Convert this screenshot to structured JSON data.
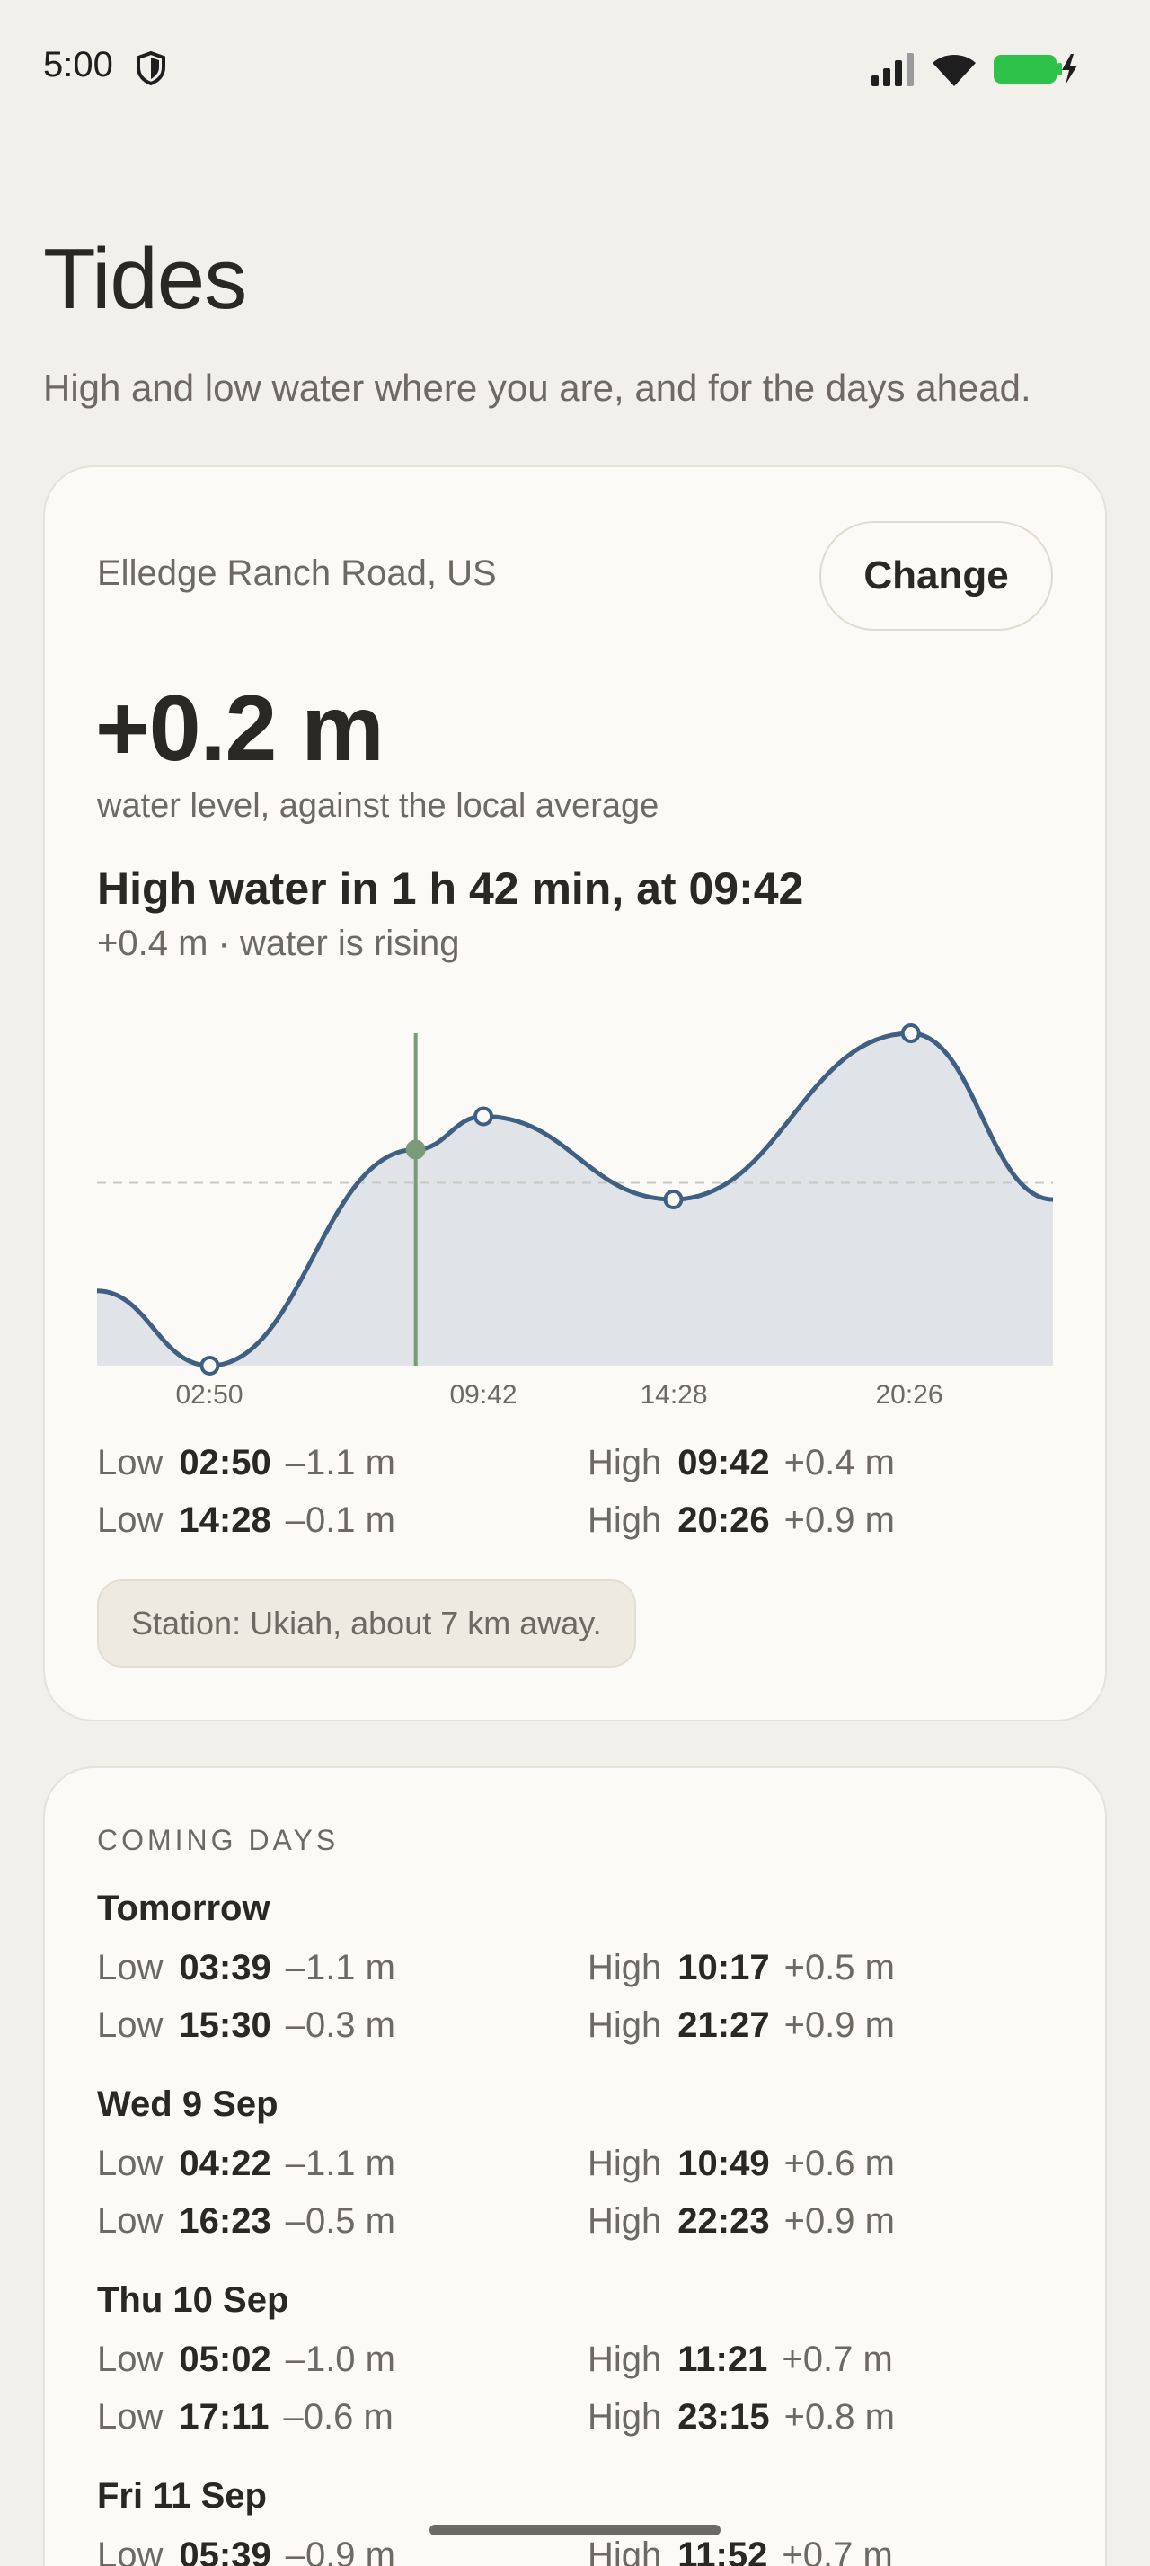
{
  "status": {
    "time": "5:00"
  },
  "page": {
    "title": "Tides",
    "subtitle": "High and low water where you are, and for the days ahead."
  },
  "current": {
    "location": "Elledge Ranch Road, US",
    "change_label": "Change",
    "level": "+0.2 m",
    "level_caption": "water level, against the local average",
    "next_tide": "High water in 1 h 42 min, at 09:42",
    "next_tide_sub": "+0.4 m · water is rising",
    "station": "Station: Ukiah, about 7 km away.",
    "extremes": [
      {
        "kind": "Low",
        "time": "02:50",
        "height": "–1.1 m"
      },
      {
        "kind": "High",
        "time": "09:42",
        "height": "+0.4 m"
      },
      {
        "kind": "Low",
        "time": "14:28",
        "height": "–0.1 m"
      },
      {
        "kind": "High",
        "time": "20:26",
        "height": "+0.9 m"
      }
    ]
  },
  "chart_data": {
    "type": "area",
    "x_tick_labels": [
      "02:50",
      "09:42",
      "14:28",
      "20:26"
    ],
    "y_unit": "m",
    "ylim": [
      -1.1,
      0.9
    ],
    "points": [
      {
        "t": 0.0,
        "h": -0.65
      },
      {
        "t": 2.83,
        "h": -1.1
      },
      {
        "t": 8.0,
        "h": 0.2
      },
      {
        "t": 9.7,
        "h": 0.4
      },
      {
        "t": 14.47,
        "h": -0.1
      },
      {
        "t": 20.43,
        "h": 0.9
      },
      {
        "t": 24.0,
        "h": -0.1
      }
    ],
    "extremes": [
      {
        "t": 2.83,
        "h": -1.1
      },
      {
        "t": 9.7,
        "h": 0.4
      },
      {
        "t": 14.47,
        "h": -0.1
      },
      {
        "t": 20.43,
        "h": 0.9
      }
    ],
    "now": {
      "t": 8.0,
      "h": 0.2
    },
    "reference_line_h": 0.0,
    "colors": {
      "line": "#3f5f83",
      "fill": "#e0e4e8",
      "now": "#7a9a78",
      "reference": "#c8c8c4"
    }
  },
  "coming_days": {
    "heading": "COMING DAYS",
    "days": [
      {
        "name": "Tomorrow",
        "extremes": [
          {
            "kind": "Low",
            "time": "03:39",
            "height": "–1.1 m"
          },
          {
            "kind": "High",
            "time": "10:17",
            "height": "+0.5 m"
          },
          {
            "kind": "Low",
            "time": "15:30",
            "height": "–0.3 m"
          },
          {
            "kind": "High",
            "time": "21:27",
            "height": "+0.9 m"
          }
        ]
      },
      {
        "name": "Wed 9 Sep",
        "extremes": [
          {
            "kind": "Low",
            "time": "04:22",
            "height": "–1.1 m"
          },
          {
            "kind": "High",
            "time": "10:49",
            "height": "+0.6 m"
          },
          {
            "kind": "Low",
            "time": "16:23",
            "height": "–0.5 m"
          },
          {
            "kind": "High",
            "time": "22:23",
            "height": "+0.9 m"
          }
        ]
      },
      {
        "name": "Thu 10 Sep",
        "extremes": [
          {
            "kind": "Low",
            "time": "05:02",
            "height": "–1.0 m"
          },
          {
            "kind": "High",
            "time": "11:21",
            "height": "+0.7 m"
          },
          {
            "kind": "Low",
            "time": "17:11",
            "height": "–0.6 m"
          },
          {
            "kind": "High",
            "time": "23:15",
            "height": "+0.8 m"
          }
        ]
      },
      {
        "name": "Fri 11 Sep",
        "extremes": [
          {
            "kind": "Low",
            "time": "05:39",
            "height": "–0.9 m"
          },
          {
            "kind": "High",
            "time": "11:52",
            "height": "+0.7 m"
          }
        ]
      }
    ]
  }
}
